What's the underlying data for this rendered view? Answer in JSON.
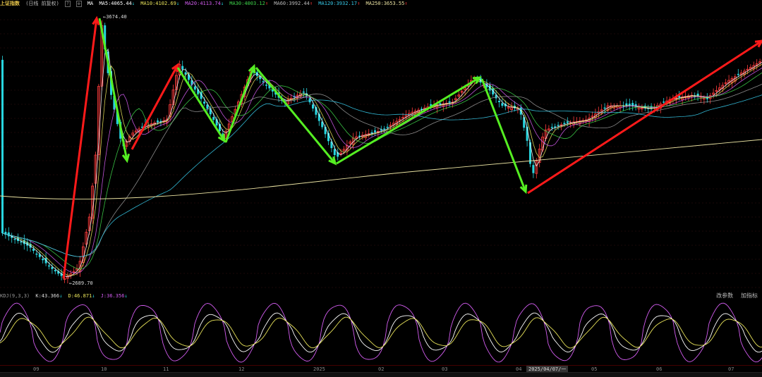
{
  "header": {
    "title": "上证指数",
    "period": "(日线 前复权)",
    "help": "?",
    "gear": "⚙",
    "ma": [
      {
        "label": "MA",
        "value": "",
        "color": "#ffffff"
      },
      {
        "label": "MA5:4065.44",
        "arrow": "↓",
        "color": "#ffffff"
      },
      {
        "label": "MA10:4102.69",
        "arrow": "↓",
        "color": "#e8e35a"
      },
      {
        "label": "MA20:4113.74",
        "arrow": "↓",
        "color": "#d35cf0"
      },
      {
        "label": "MA30:4003.12",
        "arrow": "↑",
        "color": "#3ed44a"
      },
      {
        "label": "MA60:3992.44",
        "arrow": "↑",
        "color": "#8a8a8a"
      },
      {
        "label": "MA120:3932.17",
        "arrow": "↑",
        "color": "#36c9e8"
      },
      {
        "label": "MA250:3653.55",
        "arrow": "↑",
        "color": "#e8e0a0"
      }
    ]
  },
  "annotations": {
    "high": "3674.40",
    "low": "2689.70"
  },
  "kdj": {
    "name": "KDJ(9,3,3)",
    "k": "K:43.366",
    "k_arrow": "↓",
    "d": "D:46.871",
    "d_arrow": "↓",
    "j": "J:36.356",
    "j_arrow": "↓",
    "links": [
      "改参数",
      "加指标"
    ]
  },
  "axis": {
    "labels": [
      "09",
      "10",
      "11",
      "12",
      "2025",
      "02",
      "03",
      "04",
      "05",
      "06",
      "07"
    ],
    "selected": "2025/04/07/一"
  },
  "colors": {
    "up": "#ff3b3b",
    "down": "#28d6e0",
    "red_arrow": "#ff1a1a",
    "green_arrow": "#55ee22"
  }
}
